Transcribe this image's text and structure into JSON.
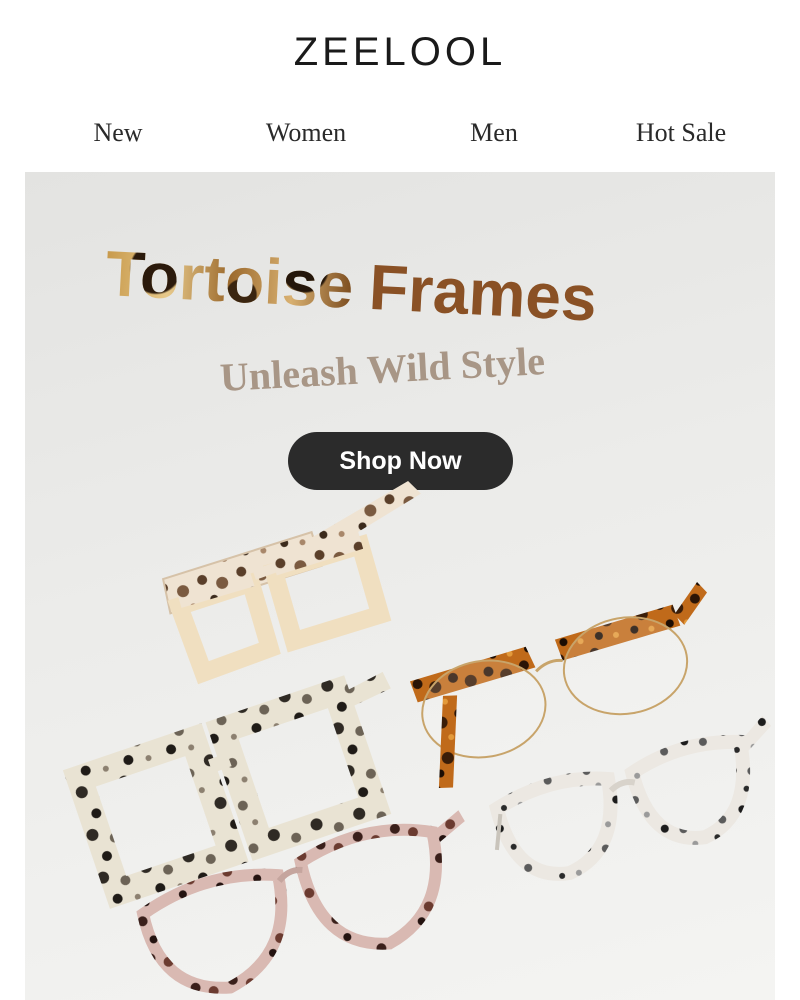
{
  "header": {
    "logo": "ZEELOOL"
  },
  "nav": {
    "items": [
      {
        "label": "New"
      },
      {
        "label": "Women"
      },
      {
        "label": "Men"
      },
      {
        "label": "Hot Sale"
      }
    ]
  },
  "hero": {
    "title_part1": "Tortoise",
    "title_part2": "Frames",
    "subtitle": "Unleash Wild Style",
    "cta_label": "Shop Now"
  },
  "colors": {
    "brand_text": "#1a1a1a",
    "title_brown": "#8a5125",
    "subtitle_taupe": "#a89686",
    "button_bg": "#2b2b2b",
    "button_text": "#ffffff"
  }
}
